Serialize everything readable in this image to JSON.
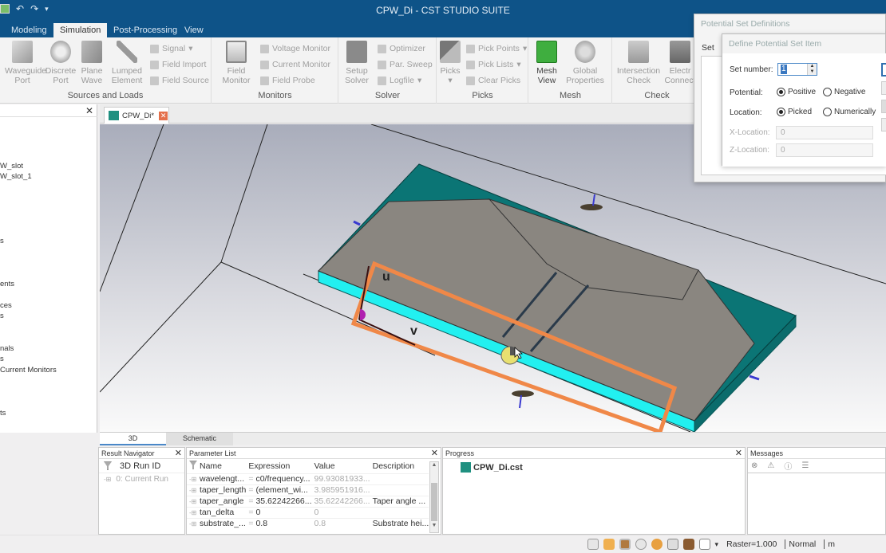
{
  "window": {
    "title": "CPW_Di - CST STUDIO SUITE"
  },
  "quick_access": {
    "icons": [
      "app-icon",
      "undo-icon",
      "redo-icon",
      "customize-icon"
    ]
  },
  "ribbon_tabs": [
    {
      "label": "Modeling",
      "active": false
    },
    {
      "label": "Simulation",
      "active": true
    },
    {
      "label": "Post-Processing",
      "active": false
    },
    {
      "label": "View",
      "active": false
    }
  ],
  "ribbon": {
    "sources_and_loads": {
      "label": "Sources and Loads",
      "big_buttons": [
        {
          "line1": "Waveguide",
          "line2": "Port"
        },
        {
          "line1": "Discrete",
          "line2": "Port"
        },
        {
          "line1": "Plane",
          "line2": "Wave"
        },
        {
          "line1": "Lumped",
          "line2": "Element"
        }
      ],
      "small_buttons": [
        "Signal",
        "Field Import",
        "Field Source"
      ]
    },
    "monitors": {
      "label": "Monitors",
      "big_button": {
        "line1": "Field",
        "line2": "Monitor"
      },
      "small_buttons": [
        "Voltage Monitor",
        "Current Monitor",
        "Field Probe"
      ]
    },
    "solver": {
      "label": "Solver",
      "big_button": {
        "line1": "Setup",
        "line2": "Solver"
      },
      "small_buttons": [
        "Optimizer",
        "Par. Sweep",
        "Logfile"
      ]
    },
    "picks": {
      "label": "Picks",
      "big_button": {
        "line1": "Picks",
        "line2": ""
      },
      "small_buttons": [
        "Pick Points",
        "Pick Lists",
        "Clear Picks"
      ]
    },
    "mesh": {
      "label": "Mesh",
      "big_buttons": [
        {
          "line1": "Mesh",
          "line2": "View"
        },
        {
          "line1": "Global",
          "line2": "Properties"
        }
      ]
    },
    "check": {
      "label": "Check",
      "big_buttons": [
        {
          "line1": "Intersection",
          "line2": "Check"
        },
        {
          "line1": "Electr",
          "line2": "Connect"
        }
      ]
    }
  },
  "navigation_tree": {
    "items": [
      "W_slot",
      "W_slot_1",
      "s",
      "ents",
      "ces",
      "s",
      "nals",
      "s",
      "Current Monitors",
      "ts"
    ]
  },
  "document_tab": {
    "label": "CPW_Di*"
  },
  "view_tabs": [
    {
      "label": "3D",
      "active": true
    },
    {
      "label": "Schematic",
      "active": false
    }
  ],
  "viewport": {
    "axis_labels": {
      "u": "u",
      "v": "v"
    },
    "colors": {
      "substrate_side": "#22f0f0",
      "ground_plane": "#0b7575",
      "conductor": "#8a8680",
      "selection_frame": "#f08848"
    }
  },
  "result_navigator": {
    "title": "Result Navigator",
    "column": "3D Run ID",
    "rows": [
      "0: Current Run"
    ]
  },
  "parameter_list": {
    "title": "Parameter List",
    "columns": [
      "Name",
      "Expression",
      "Value",
      "Description"
    ],
    "rows": [
      {
        "name": "wavelengt...",
        "expression": "c0/frequency...",
        "value": "99.93081933...",
        "description": ""
      },
      {
        "name": "taper_length",
        "expression": "(element_wi...",
        "value": "3.985951916...",
        "description": ""
      },
      {
        "name": "taper_angle",
        "expression": "35.62242266...",
        "value": "35.62242266...",
        "description": "Taper angle ..."
      },
      {
        "name": "tan_delta",
        "expression": "0",
        "value": "0",
        "description": ""
      },
      {
        "name": "substrate_...",
        "expression": "0.8",
        "value": "0.8",
        "description": "Substrate hei..."
      }
    ]
  },
  "progress_panel": {
    "title": "Progress",
    "items": [
      "CPW_Di.cst"
    ]
  },
  "messages_panel": {
    "title": "Messages"
  },
  "status_bar": {
    "raster": "Raster=1.000",
    "mode": "Normal",
    "trailing": "m"
  },
  "dialog_potential_set_definitions": {
    "title": "Potential Set Definitions",
    "tab_label": "Set"
  },
  "dialog_define_potential_set_item": {
    "title": "Define Potential Set Item",
    "set_number_label": "Set number:",
    "set_number_value": "1",
    "potential_label": "Potential:",
    "potential_options": [
      "Positive",
      "Negative"
    ],
    "potential_selected": "Positive",
    "location_label": "Location:",
    "location_options": [
      "Picked",
      "Numerically"
    ],
    "location_selected": "Picked",
    "x_location_label": "X-Location:",
    "x_location_value": "0",
    "z_location_label": "Z-Location:",
    "z_location_value": "0"
  }
}
